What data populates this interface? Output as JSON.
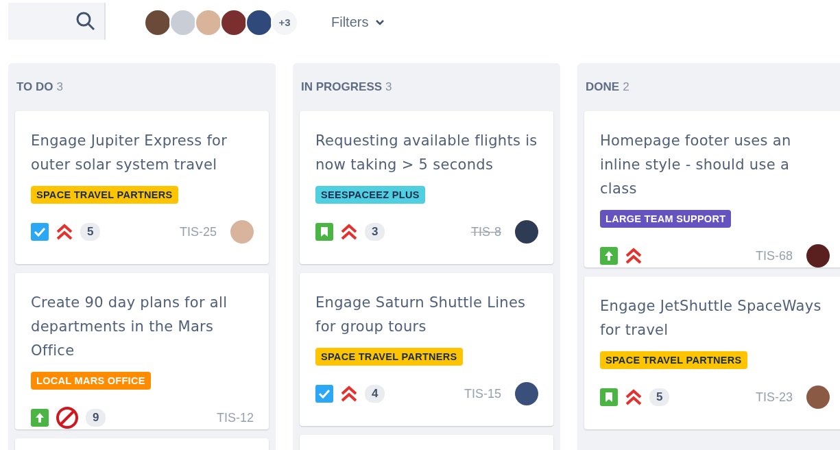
{
  "toolbar": {
    "avatars": [
      {
        "color": "#6b4a3a"
      },
      {
        "color": "#c9ced6"
      },
      {
        "color": "#d9b39a"
      },
      {
        "color": "#7a2e2e"
      },
      {
        "color": "#2f4a7a"
      }
    ],
    "more_avatars": "+3",
    "filters": "Filters"
  },
  "columns": [
    {
      "title": "TO DO",
      "count": "3",
      "more_below": true,
      "cards": [
        {
          "summary": "Engage Jupiter Express for outer solar system travel",
          "label": {
            "text": "SPACE TRAVEL PARTNERS",
            "color": "#ffc400"
          },
          "kind": "task",
          "blocked": false,
          "estimate": "5",
          "key": "TIS-25",
          "resolved": false,
          "assignee": {
            "color": "#d8b49c"
          }
        },
        {
          "summary": "Create 90 day plans for all departments in the Mars Office",
          "label": {
            "text": "LOCAL MARS OFFICE",
            "color": "#ff8b00"
          },
          "kind": "improvement",
          "blocked": true,
          "estimate": "9",
          "key": "TIS-12",
          "resolved": false
        }
      ]
    },
    {
      "title": "IN PROGRESS",
      "count": "3",
      "more_below": true,
      "cards": [
        {
          "summary": "Requesting available flights is now taking > 5 seconds",
          "label": {
            "text": "SEESPACEEZ PLUS",
            "color": "#4fcfe0"
          },
          "kind": "story",
          "blocked": false,
          "estimate": "3",
          "key": "TIS-8",
          "resolved": true,
          "assignee": {
            "color": "#2d3b55"
          }
        },
        {
          "summary": "Engage Saturn Shuttle Lines for group tours",
          "label": {
            "text": "SPACE TRAVEL PARTNERS",
            "color": "#ffc400"
          },
          "kind": "task",
          "blocked": false,
          "estimate": "4",
          "key": "TIS-15",
          "resolved": false,
          "assignee": {
            "color": "#3a4f7a"
          }
        }
      ]
    },
    {
      "title": "DONE",
      "count": "2",
      "more_below": false,
      "cards": [
        {
          "summary": "Homepage footer uses an inline style - should use a class",
          "label": {
            "text": "LARGE TEAM SUPPORT",
            "color": "#6554c0"
          },
          "kind": "improvement",
          "blocked": false,
          "key": "TIS-68",
          "resolved": false,
          "assignee": {
            "color": "#5a1f1f"
          }
        },
        {
          "summary": "Engage JetShuttle SpaceWays for travel",
          "label": {
            "text": "SPACE TRAVEL PARTNERS",
            "color": "#ffc400"
          },
          "kind": "story",
          "blocked": false,
          "estimate": "5",
          "key": "TIS-23",
          "resolved": false,
          "assignee": {
            "color": "#8a5a44"
          }
        }
      ]
    }
  ]
}
